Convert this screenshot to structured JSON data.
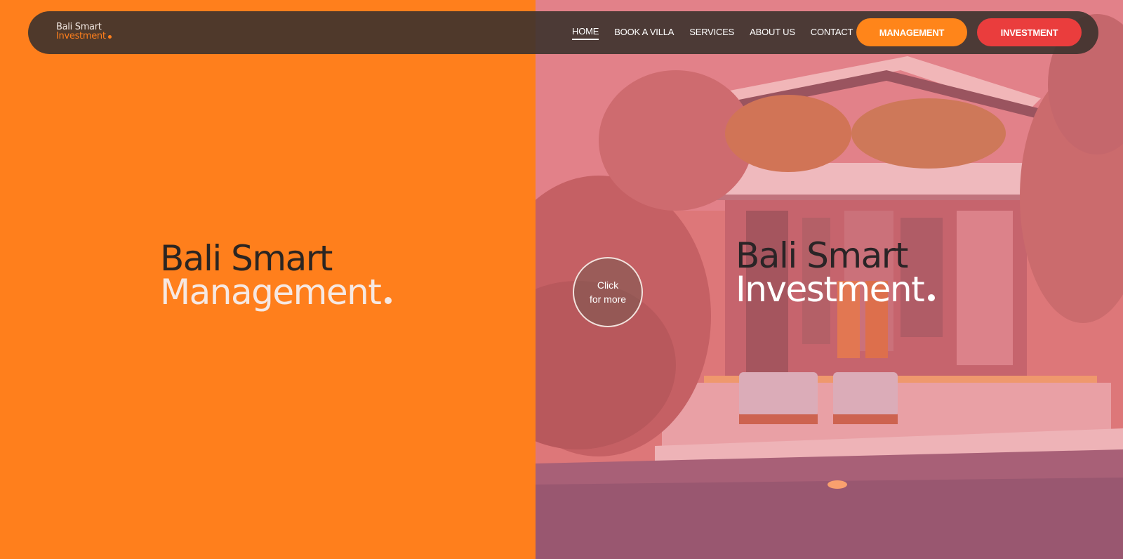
{
  "brand": {
    "logo_line1": "Bali Smart",
    "logo_line2": "Investment"
  },
  "nav": {
    "items": [
      {
        "label": "HOME",
        "active": true
      },
      {
        "label": "BOOK A VILLA",
        "active": false
      },
      {
        "label": "SERVICES",
        "active": false
      },
      {
        "label": "ABOUT US",
        "active": false
      },
      {
        "label": "CONTACT",
        "active": false
      }
    ],
    "management_button": "MANAGEMENT",
    "investment_button": "INVESTMENT"
  },
  "hero_left": {
    "line1": "Bali Smart",
    "line2": "Management"
  },
  "hero_right": {
    "line1": "Bali Smart",
    "line2": "Investment",
    "click_line1": "Click",
    "click_line2": "for more"
  },
  "colors": {
    "orange": "#ff7f1c",
    "navbar": "#3c322e",
    "management_button": "#ff851a",
    "investment_button": "#ea3d3d"
  }
}
